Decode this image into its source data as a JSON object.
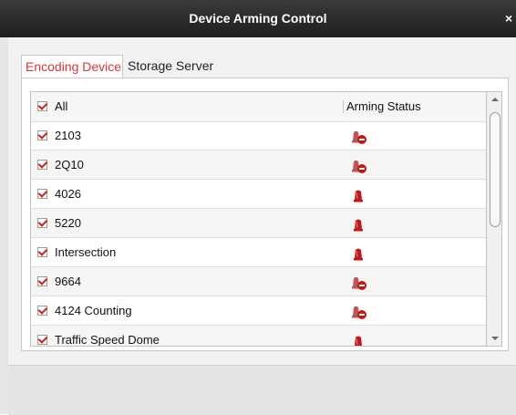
{
  "window": {
    "title": "Device Arming Control",
    "close_label": "×"
  },
  "tabs": [
    {
      "label": "Encoding Device",
      "active": true
    },
    {
      "label": "Storage Server",
      "active": false
    }
  ],
  "list": {
    "header": {
      "all_label": "All",
      "status_label": "Arming Status"
    },
    "rows": [
      {
        "name": "2103",
        "checked": true,
        "status_icon": "disarmed-alarm-icon"
      },
      {
        "name": "2Q10",
        "checked": true,
        "status_icon": "disarmed-alarm-icon"
      },
      {
        "name": "4026",
        "checked": true,
        "status_icon": "armed-alarm-icon"
      },
      {
        "name": "5220",
        "checked": true,
        "status_icon": "armed-alarm-icon"
      },
      {
        "name": "Intersection",
        "checked": true,
        "status_icon": "armed-alarm-icon"
      },
      {
        "name": "9664",
        "checked": true,
        "status_icon": "disarmed-alarm-icon"
      },
      {
        "name": "4124 Counting",
        "checked": true,
        "status_icon": "disarmed-alarm-icon"
      },
      {
        "name": "Traffic Speed Dome",
        "checked": true,
        "status_icon": "armed-alarm-icon"
      }
    ]
  },
  "colors": {
    "accent": "#d93636",
    "titlebar": "#2b2b2b",
    "alarm_red": "#c0191c"
  }
}
